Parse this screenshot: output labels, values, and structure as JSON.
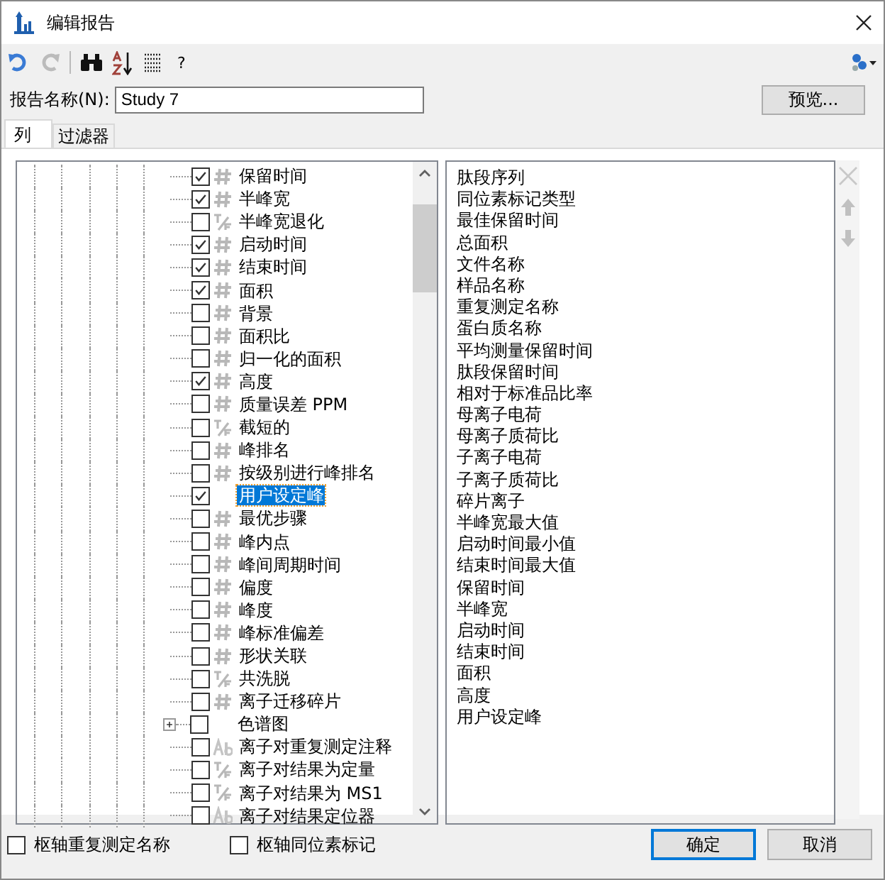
{
  "window": {
    "title": "编辑报告"
  },
  "toolbar": {
    "help": "?"
  },
  "report_name": {
    "label": "报告名称(N):",
    "value": "Study 7"
  },
  "preview_button": "预览...",
  "tabs": [
    {
      "label": "列",
      "selected": true
    },
    {
      "label": "过滤器",
      "selected": false
    }
  ],
  "columns_tree": [
    {
      "label": "保留时间",
      "checked": true,
      "kind": "number",
      "selected": false
    },
    {
      "label": "半峰宽",
      "checked": true,
      "kind": "number",
      "selected": false
    },
    {
      "label": "半峰宽退化",
      "checked": false,
      "kind": "boolean",
      "selected": false
    },
    {
      "label": "启动时间",
      "checked": true,
      "kind": "number",
      "selected": false
    },
    {
      "label": "结束时间",
      "checked": true,
      "kind": "number",
      "selected": false
    },
    {
      "label": "面积",
      "checked": true,
      "kind": "number",
      "selected": false
    },
    {
      "label": "背景",
      "checked": false,
      "kind": "number",
      "selected": false
    },
    {
      "label": "面积比",
      "checked": false,
      "kind": "number",
      "selected": false
    },
    {
      "label": "归一化的面积",
      "checked": false,
      "kind": "number",
      "selected": false
    },
    {
      "label": "高度",
      "checked": true,
      "kind": "number",
      "selected": false
    },
    {
      "label": "质量误差 PPM",
      "checked": false,
      "kind": "number",
      "selected": false
    },
    {
      "label": "截短的",
      "checked": false,
      "kind": "boolean",
      "selected": false
    },
    {
      "label": "峰排名",
      "checked": false,
      "kind": "number",
      "selected": false
    },
    {
      "label": "按级别进行峰排名",
      "checked": false,
      "kind": "number",
      "selected": false
    },
    {
      "label": "用户设定峰",
      "checked": true,
      "kind": "none",
      "selected": true
    },
    {
      "label": "最优步骤",
      "checked": false,
      "kind": "number",
      "selected": false
    },
    {
      "label": "峰内点",
      "checked": false,
      "kind": "number",
      "selected": false
    },
    {
      "label": "峰间周期时间",
      "checked": false,
      "kind": "number",
      "selected": false
    },
    {
      "label": "偏度",
      "checked": false,
      "kind": "number",
      "selected": false
    },
    {
      "label": "峰度",
      "checked": false,
      "kind": "number",
      "selected": false
    },
    {
      "label": "峰标准偏差",
      "checked": false,
      "kind": "number",
      "selected": false
    },
    {
      "label": "形状关联",
      "checked": false,
      "kind": "number",
      "selected": false
    },
    {
      "label": "共洗脱",
      "checked": false,
      "kind": "boolean",
      "selected": false
    },
    {
      "label": "离子迁移碎片",
      "checked": false,
      "kind": "number",
      "selected": false
    },
    {
      "label": "色谱图",
      "checked": false,
      "kind": "none",
      "selected": false,
      "expanded": false
    },
    {
      "label": "离子对重复测定注释",
      "checked": false,
      "kind": "text",
      "selected": false
    },
    {
      "label": "离子对结果为定量",
      "checked": false,
      "kind": "boolean",
      "selected": false
    },
    {
      "label": "离子对结果为 MS1",
      "checked": false,
      "kind": "boolean",
      "selected": false
    },
    {
      "label": "离子对结果定位器",
      "checked": false,
      "kind": "text",
      "selected": false
    }
  ],
  "selected_columns": [
    "肽段序列",
    "同位素标记类型",
    "最佳保留时间",
    "总面积",
    "文件名称",
    "样品名称",
    "重复测定名称",
    "蛋白质名称",
    "平均测量保留时间",
    "肽段保留时间",
    "相对于标准品比率",
    "母离子电荷",
    "母离子质荷比",
    "子离子电荷",
    "子离子质荷比",
    "碎片离子",
    "半峰宽最大值",
    "启动时间最小值",
    "结束时间最大值",
    "保留时间",
    "半峰宽",
    "启动时间",
    "结束时间",
    "面积",
    "高度",
    "用户设定峰"
  ],
  "options": [
    {
      "label": "枢轴重复测定名称",
      "checked": false
    },
    {
      "label": "枢轴同位素标记",
      "checked": false
    }
  ],
  "buttons": [
    {
      "label": "确定",
      "kind": "default"
    },
    {
      "label": "取消",
      "kind": "normal"
    }
  ]
}
